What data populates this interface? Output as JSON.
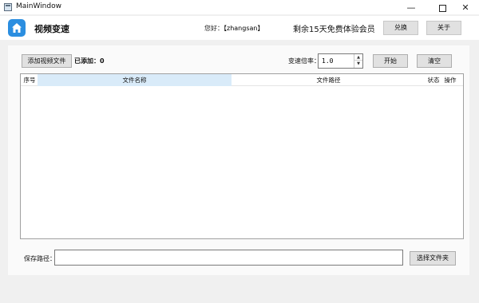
{
  "window": {
    "title": "MainWindow",
    "minimize_glyph": "—",
    "close_glyph": "✕"
  },
  "header": {
    "app_name": "视频变速",
    "greeting_prefix": "您好：",
    "username": "【zhangsan】",
    "trial_text": "剩余15天免费体验会员",
    "redeem_label": "兑换",
    "about_label": "关于",
    "logo_icon": "home-icon",
    "brand_color": "#2b8ee0"
  },
  "toolbar": {
    "add_video_label": "添加视频文件",
    "added_label": "已添加：",
    "added_count": "0",
    "rate_label": "变速倍率：",
    "rate_value": "1.0",
    "start_label": "开始",
    "clear_label": "清空"
  },
  "table": {
    "columns": [
      "序号",
      "文件名称",
      "文件路径",
      "状态",
      "操作"
    ],
    "rows": []
  },
  "save": {
    "label": "保存路径：",
    "value": "",
    "browse_label": "选择文件夹"
  }
}
